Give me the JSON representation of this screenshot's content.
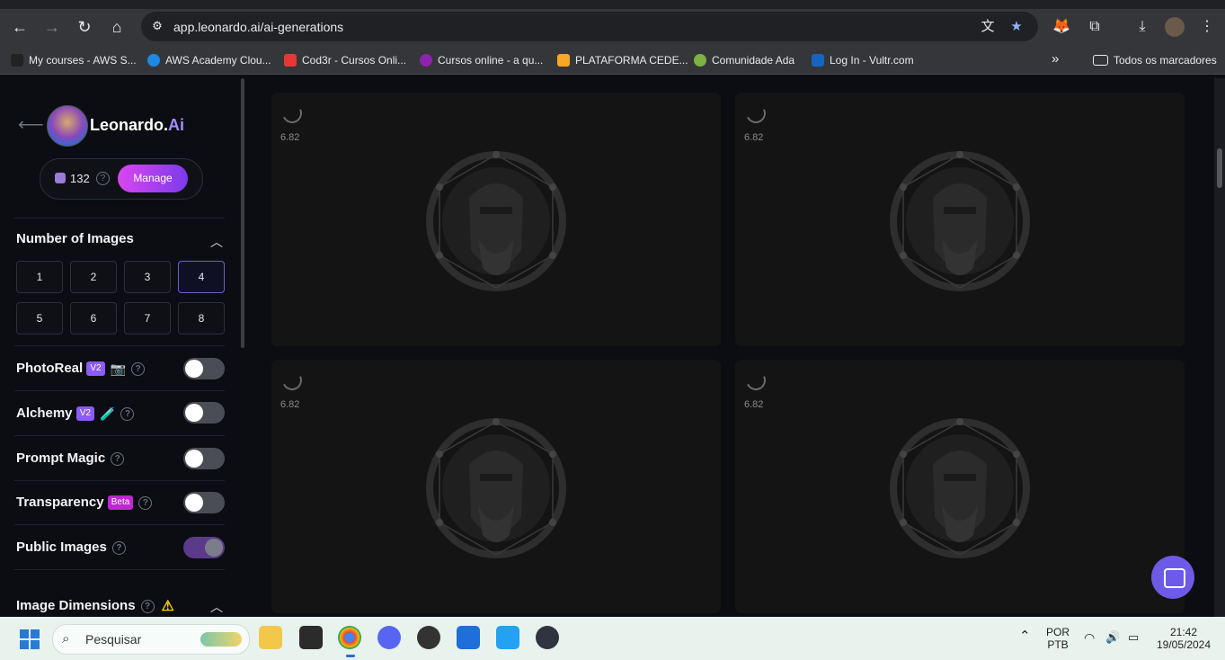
{
  "browser": {
    "url": "app.leonardo.ai/ai-generations",
    "bookmarks": [
      {
        "label": "My courses - AWS S...",
        "color": "#222222"
      },
      {
        "label": "AWS Academy Clou...",
        "color": "#1e88e5"
      },
      {
        "label": "Cod3r - Cursos Onli...",
        "color": "#e53935"
      },
      {
        "label": "Cursos online - a qu...",
        "color": "#8e24aa"
      },
      {
        "label": "PLATAFORMA CEDE...",
        "color": "#f9a825"
      },
      {
        "label": "Comunidade Ada",
        "color": "#7cb342"
      },
      {
        "label": "Log In - Vultr.com",
        "color": "#1565c0"
      }
    ],
    "more_bookmarks": "»",
    "all_bookmarks": "Todos os marcadores"
  },
  "sidebar": {
    "brand": "Leonardo.",
    "brand_ai": "Ai",
    "credits": "132",
    "manage_label": "Manage",
    "number_of_images": {
      "title": "Number of Images",
      "options": [
        "1",
        "2",
        "3",
        "4",
        "5",
        "6",
        "7",
        "8"
      ],
      "selected": "4"
    },
    "toggles": {
      "photoreal": {
        "label": "PhotoReal",
        "badge": "V2",
        "on": false
      },
      "alchemy": {
        "label": "Alchemy",
        "badge": "V2",
        "on": false
      },
      "prompt_magic": {
        "label": "Prompt Magic",
        "on": false
      },
      "transparency": {
        "label": "Transparency",
        "badge": "Beta",
        "on": false
      },
      "public_images": {
        "label": "Public Images",
        "on": true
      }
    },
    "image_dimensions": "Image Dimensions"
  },
  "generations": [
    {
      "value": "6.82"
    },
    {
      "value": "6.82"
    },
    {
      "value": "6.82"
    },
    {
      "value": "6.82"
    }
  ],
  "taskbar": {
    "search_placeholder": "Pesquisar",
    "lang_top": "POR",
    "lang_bottom": "PTB",
    "time": "21:42",
    "date": "19/05/2024"
  }
}
